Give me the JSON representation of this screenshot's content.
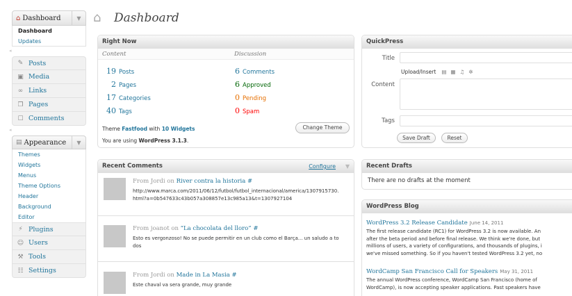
{
  "page_title": "Dashboard",
  "sidebar": {
    "dashboard": {
      "label": "Dashboard",
      "subitems": [
        "Dashboard",
        "Updates"
      ]
    },
    "items": [
      {
        "label": "Posts",
        "icon": "pushpin-icon"
      },
      {
        "label": "Media",
        "icon": "media-icon"
      },
      {
        "label": "Links",
        "icon": "link-icon"
      },
      {
        "label": "Pages",
        "icon": "pages-icon"
      },
      {
        "label": "Comments",
        "icon": "comments-icon"
      }
    ],
    "appearance": {
      "label": "Appearance",
      "subitems": [
        "Themes",
        "Widgets",
        "Menus",
        "Theme Options",
        "Header",
        "Background",
        "Editor"
      ]
    },
    "items2": [
      {
        "label": "Plugins",
        "icon": "plug-icon"
      },
      {
        "label": "Users",
        "icon": "users-icon"
      },
      {
        "label": "Tools",
        "icon": "tools-icon"
      },
      {
        "label": "Settings",
        "icon": "settings-icon"
      }
    ]
  },
  "right_now": {
    "title": "Right Now",
    "content_heading": "Content",
    "discussion_heading": "Discussion",
    "content": [
      {
        "num": "19",
        "label": "Posts"
      },
      {
        "num": "2",
        "label": "Pages"
      },
      {
        "num": "17",
        "label": "Categories"
      },
      {
        "num": "40",
        "label": "Tags"
      }
    ],
    "discussion": [
      {
        "num": "6",
        "label": "Comments",
        "color": "#21759b"
      },
      {
        "num": "6",
        "label": "Approved",
        "color": "#006505"
      },
      {
        "num": "0",
        "label": "Pending",
        "color": "#e66f00"
      },
      {
        "num": "0",
        "label": "Spam",
        "color": "#ff0000"
      }
    ],
    "theme_prefix": "Theme",
    "theme_name": "Fastfood",
    "theme_with": "with",
    "widgets_count": "10 Widgets",
    "version_prefix": "You are using",
    "version": "WordPress 3.1.3",
    "version_suffix": ".",
    "change_theme": "Change Theme"
  },
  "quickpress": {
    "title": "QuickPress",
    "title_label": "Title",
    "upload_insert": "Upload/Insert",
    "content_label": "Content",
    "tags_label": "Tags",
    "save_draft": "Save Draft",
    "reset": "Reset"
  },
  "recent_comments": {
    "title": "Recent Comments",
    "configure": "Configure",
    "comments": [
      {
        "author": "From Jordi on",
        "post": "River contra la historia",
        "hash": "#",
        "text": "http://www.marca.com/2011/06/12/futbol/futbol_internacional/america/1307915730.html?a=0b547633c43b057a308857e13c985a13&t=1307927104"
      },
      {
        "author": "From joanot on",
        "post": "“La chocolata del lloro”",
        "hash": "#",
        "text": "Esto es vergonzoso! No se puede permitir en un club como el Barça... un saludo a todos"
      },
      {
        "author": "From Jordi on",
        "post": "Made in La Masia",
        "hash": "#",
        "text": "Este chaval va sera grande, muy grande"
      }
    ]
  },
  "recent_drafts": {
    "title": "Recent Drafts",
    "empty": "There are no drafts at the moment"
  },
  "wp_blog": {
    "title": "WordPress Blog",
    "posts": [
      {
        "title": "WordPress 3.2 Release Candidate",
        "date": "June 14, 2011",
        "lines": [
          "The first release candidate (RC1) for WordPress 3.2 is now available. An",
          "after the beta period and before final release. We think we're done, but",
          "millions of users, a variety of configurations, and thousands of plugins, i",
          "we've missed something. So if you haven't tested WordPress 3.2 yet, no"
        ]
      },
      {
        "title": "WordCamp San Francisco Call for Speakers",
        "date": "May 31, 2011",
        "lines": [
          "The annual WordPress conference, WordCamp San Francisco (home of",
          "WordCamp), is now accepting speaker applications. Past speakers have"
        ]
      }
    ]
  }
}
